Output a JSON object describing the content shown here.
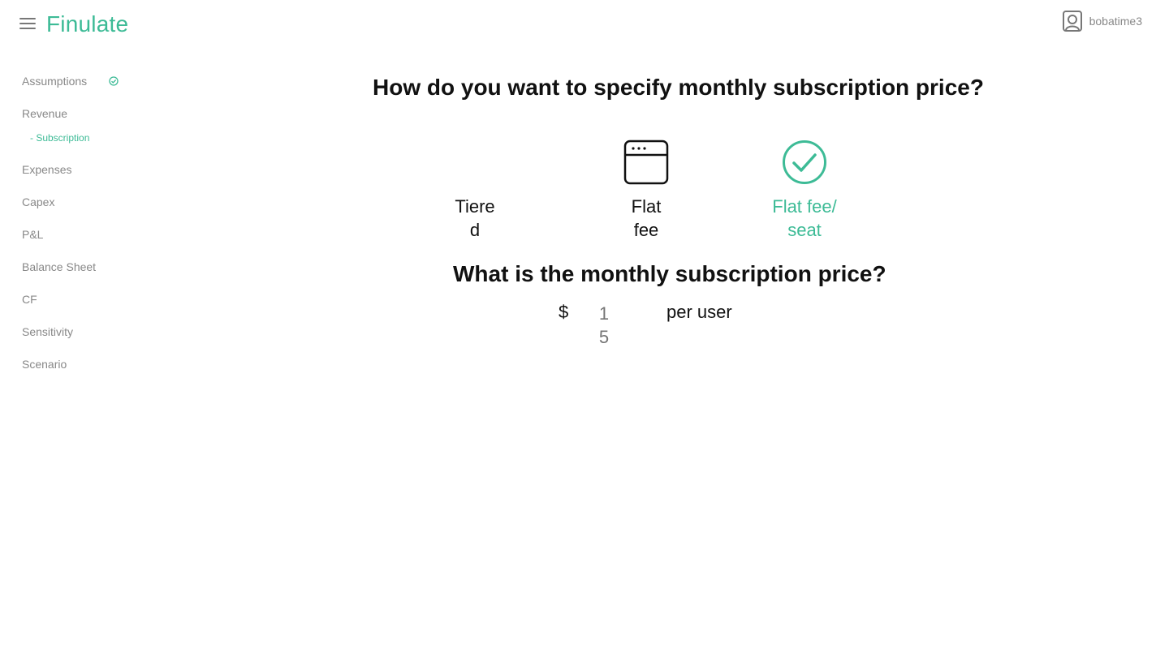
{
  "app": {
    "brand": "Finulate",
    "accent_color": "#3dbb96",
    "menu_icon": "hamburger-icon"
  },
  "user": {
    "name": "bobatime3",
    "icon": "user-avatar-icon"
  },
  "sidebar": {
    "items": [
      {
        "label": "Assumptions",
        "completed": true,
        "icon": "check-circle-icon"
      },
      {
        "label": "Revenue"
      },
      {
        "label": "- Subscription",
        "sub": true,
        "active": true
      },
      {
        "label": "Expenses"
      },
      {
        "label": "Capex"
      },
      {
        "label": "P&L"
      },
      {
        "label": "Balance Sheet"
      },
      {
        "label": "CF"
      },
      {
        "label": "Sensitivity"
      },
      {
        "label": "Scenario"
      }
    ]
  },
  "main": {
    "question_pricing_method": "How do you want to specify monthly subscription price?",
    "options": [
      {
        "label": "Tiered",
        "icon": "none",
        "selected": false
      },
      {
        "label": "Flat fee",
        "icon": "browser-window-icon",
        "selected": false
      },
      {
        "label": "Flat fee/ seat",
        "icon": "check-circle-icon",
        "selected": true
      }
    ],
    "question_price": "What is the monthly subscription price?",
    "currency_symbol": "$",
    "price_placeholder": "15",
    "unit_label": "per user"
  }
}
